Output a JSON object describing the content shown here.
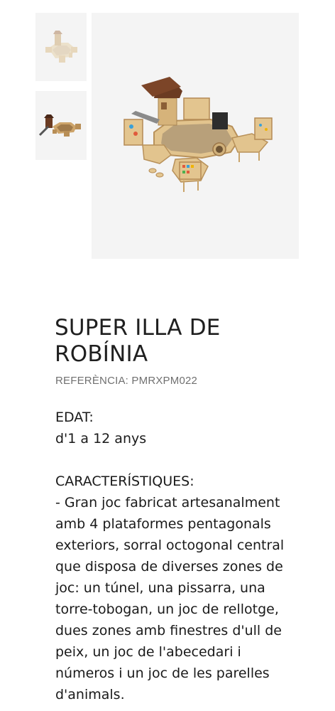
{
  "gallery": {
    "thumbnails": [
      {
        "icon": "playground-thumbnail-light"
      },
      {
        "icon": "playground-thumbnail-dark"
      }
    ],
    "main_image_icon": "playground-main-image"
  },
  "product": {
    "title": "SUPER ILLA DE ROBÍNIA",
    "reference": "REFERÈNCIA: PMRXPM022",
    "age_label": "EDAT:",
    "age_value": "d'1 a 12 anys",
    "features_label": "CARACTERÍSTIQUES:",
    "features_text": "- Gran joc fabricat artesanalment amb 4 plataformes pentagonals exteriors, sorral octogonal central que disposa de diverses zones de joc: un túnel, una pissarra, una torre-tobogan, un joc de rellotge, dues zones amb finestres d'ull de peix, un joc de l'abecedari i números i un joc de les parelles d'animals."
  },
  "colors": {
    "image_background": "#f4f4f4",
    "wood": "#d9b77a",
    "sand": "#b59a72",
    "roof": "#6b3b22"
  }
}
